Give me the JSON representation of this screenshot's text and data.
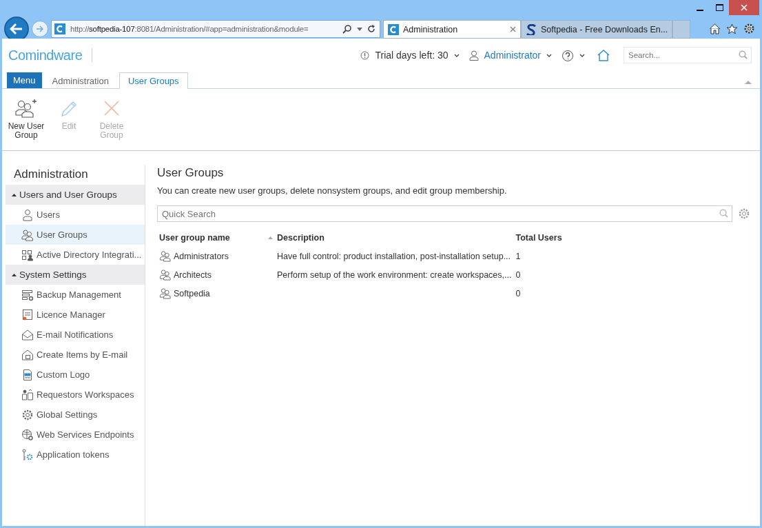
{
  "browser": {
    "url_scheme": "http://",
    "url_host": "softpedia-107",
    "url_rest": ":8081/Administration/#app=administration&module=",
    "tabs": [
      {
        "title": "Administration",
        "selected": true,
        "kind": "c"
      },
      {
        "title": "Softpedia - Free Downloads En...",
        "selected": false,
        "kind": "s"
      }
    ]
  },
  "header": {
    "logo": "Comindware",
    "trial": "Trial days left: 30",
    "user": "Administrator",
    "search": {
      "placeholder": "Search..."
    }
  },
  "app_tabs": [
    {
      "label": "Menu",
      "kind": "menu",
      "selected": false
    },
    {
      "label": "Administration",
      "kind": "tab",
      "selected": false
    },
    {
      "label": "User Groups",
      "kind": "tab",
      "selected": true
    }
  ],
  "toolbar": [
    {
      "label": "New User Group",
      "kind": "add",
      "disabled": false
    },
    {
      "label": "Edit",
      "kind": "edit",
      "disabled": true
    },
    {
      "label": "Delete Group",
      "kind": "delete",
      "disabled": true
    }
  ],
  "sidebar": {
    "title": "Administration",
    "sections": [
      {
        "label": "Users and User Groups",
        "expanded": true,
        "items": [
          {
            "label": "Users",
            "kind": "user",
            "selected": false
          },
          {
            "label": "User Groups",
            "kind": "group",
            "selected": true
          },
          {
            "label": "Active Directory Integrati...",
            "kind": "directory",
            "selected": false
          }
        ]
      },
      {
        "label": "System Settings",
        "expanded": true,
        "items": [
          {
            "label": "Backup Management",
            "kind": "backup",
            "selected": false
          },
          {
            "label": "Licence Manager",
            "kind": "licence",
            "selected": false
          },
          {
            "label": "E-mail Notifications",
            "kind": "mail",
            "selected": false
          },
          {
            "label": "Create Items by E-mail",
            "kind": "mailbox",
            "selected": false
          },
          {
            "label": "Custom Logo",
            "kind": "logo",
            "selected": false
          },
          {
            "label": "Requestors Workspaces",
            "kind": "workspace",
            "selected": false
          },
          {
            "label": "Global Settings",
            "kind": "gear",
            "selected": false
          },
          {
            "label": "Web Services Endpoints",
            "kind": "globe",
            "selected": false
          },
          {
            "label": "Application tokens",
            "kind": "token",
            "selected": false
          }
        ]
      }
    ]
  },
  "main": {
    "title": "User Groups",
    "description": "You can create new user groups, delete nonsystem groups, and edit group membership.",
    "search": {
      "placeholder": "Quick Search"
    },
    "columns": [
      "User group name",
      "Description",
      "Total Users"
    ],
    "rows": [
      {
        "name": "Administrators",
        "description": "Have full control: product installation, post-installation setup...",
        "total": "1"
      },
      {
        "name": "Architects",
        "description": "Perform setup of the work environment: create workspaces,...",
        "total": "0"
      },
      {
        "name": "Softpedia",
        "description": "",
        "total": "0"
      }
    ]
  }
}
